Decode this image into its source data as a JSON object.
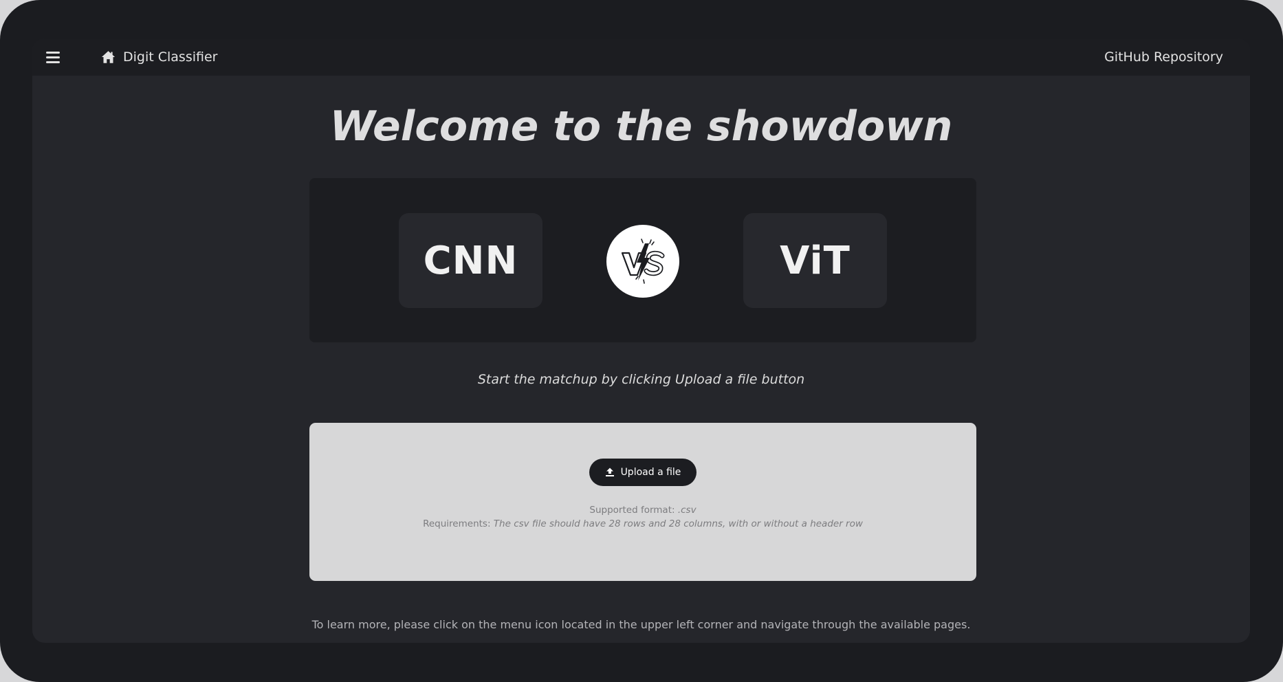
{
  "topbar": {
    "menu_icon": "hamburger-menu-icon",
    "home_icon": "home-icon",
    "app_title": "Digit Classifier",
    "github_link": "GitHub Repository"
  },
  "main": {
    "title": "Welcome to the showdown",
    "left_model": "CNN",
    "right_model": "ViT",
    "vs_icon": "versus-lightning-icon",
    "hint": "Start the matchup by clicking Upload a file button"
  },
  "uploader": {
    "button_icon": "upload-icon",
    "button_label": "Upload a file",
    "format_label": "Supported format:",
    "format_value": ".csv",
    "requirements_label": "Requirements:",
    "requirements_value": "The csv file should have 28 rows and 28 columns, with or without a header row"
  },
  "footer": {
    "text": "To learn more, please click on the menu icon located in the upper left corner and navigate through the available pages."
  },
  "colors": {
    "frame": "#1b1c20",
    "background": "#25262b",
    "topbar": "#1c1d21",
    "panel": "#1c1d21",
    "card": "#27282d",
    "dropzone": "#d7d7d8"
  }
}
